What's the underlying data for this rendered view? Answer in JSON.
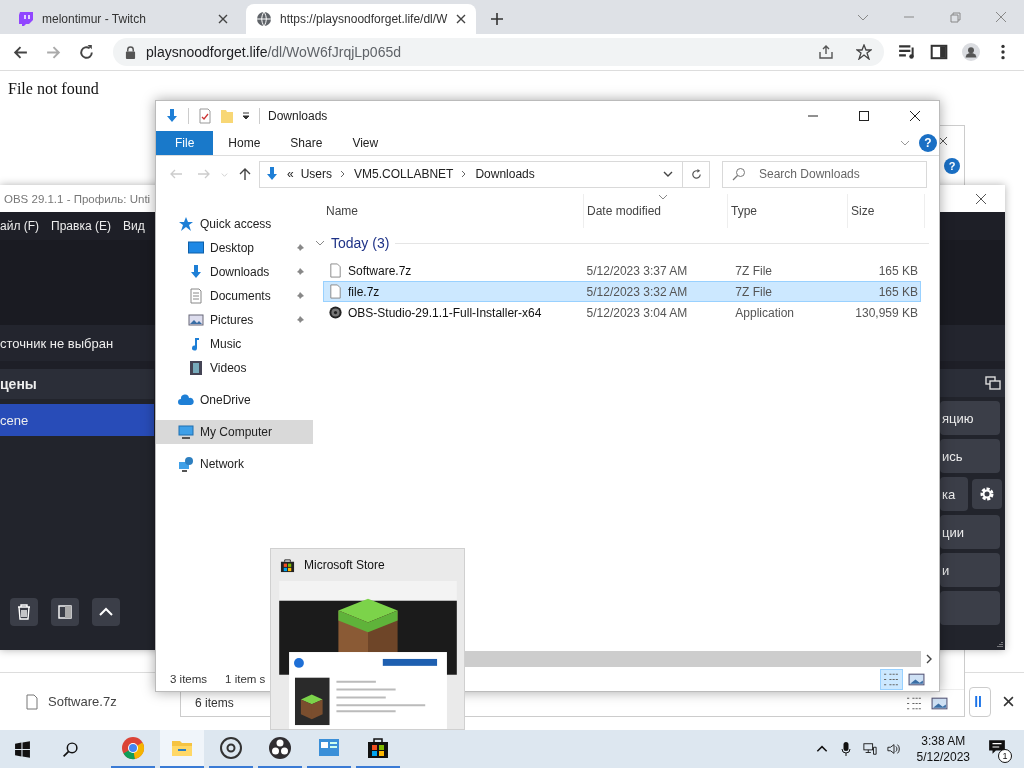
{
  "browser": {
    "tabs": [
      {
        "title": "melontimur - Twitch",
        "selected": false
      },
      {
        "title": "https://playsnoodforget.life/dl/W",
        "selected": true
      }
    ],
    "url": {
      "domain": "playsnoodforget.life",
      "path": "/dl/WoW6fJrqjLp065d"
    },
    "page_text": "File not found",
    "download_bar": {
      "file": "Software.7z",
      "button_text": "ll"
    }
  },
  "obs": {
    "title": "OBS 29.1.1 - Профиль: Unti",
    "menu": [
      "айл (F)",
      "Правка (E)",
      "Вид"
    ],
    "no_source": "сточник не выбран",
    "scenes_title": "цены",
    "scenes": [
      {
        "name": "cene",
        "selected": true
      }
    ],
    "controls": [
      {
        "label": "яцию",
        "kind": "button"
      },
      {
        "label": "ись",
        "kind": "button"
      },
      {
        "label": "ка",
        "kind": "settings"
      },
      {
        "label": "ции",
        "kind": "button"
      },
      {
        "label": "и",
        "kind": "button"
      }
    ]
  },
  "back_explorer": {
    "help": "?",
    "status": "6 items"
  },
  "explorer": {
    "title": "Downloads",
    "ribbon_tabs": [
      {
        "label": "File",
        "selected": true
      },
      {
        "label": "Home",
        "selected": false
      },
      {
        "label": "Share",
        "selected": false
      },
      {
        "label": "View",
        "selected": false
      }
    ],
    "help": "?",
    "breadcrumb_prefix": "«",
    "breadcrumb": [
      "Users",
      "VM5.COLLABNET",
      "Downloads"
    ],
    "search": {
      "placeholder": "Search Downloads"
    },
    "nav": [
      {
        "label": "Quick access",
        "pinned": false,
        "selected": false,
        "children": [
          {
            "label": "Desktop",
            "pinned": true,
            "selected": false
          },
          {
            "label": "Downloads",
            "pinned": true,
            "selected": false
          },
          {
            "label": "Documents",
            "pinned": true,
            "selected": false
          },
          {
            "label": "Pictures",
            "pinned": true,
            "selected": false
          },
          {
            "label": "Music",
            "pinned": false,
            "selected": false
          },
          {
            "label": "Videos",
            "pinned": false,
            "selected": false
          }
        ]
      },
      {
        "label": "OneDrive",
        "pinned": false,
        "selected": false
      },
      {
        "label": "My Computer",
        "pinned": false,
        "selected": true
      },
      {
        "label": "Network",
        "pinned": false,
        "selected": false
      }
    ],
    "columns": [
      "Name",
      "Date modified",
      "Type",
      "Size"
    ],
    "group": "Today (3)",
    "files": [
      {
        "name": "Software.7z",
        "date": "5/12/2023 3:37 AM",
        "type": "7Z File",
        "size": "165 KB",
        "kind": "file",
        "selected": false
      },
      {
        "name": "file.7z",
        "date": "5/12/2023 3:32 AM",
        "type": "7Z File",
        "size": "165 KB",
        "kind": "file",
        "selected": true
      },
      {
        "name": "OBS-Studio-29.1.1-Full-Installer-x64",
        "date": "5/12/2023 3:04 AM",
        "type": "Application",
        "size": "130,959 KB",
        "kind": "application",
        "selected": false
      }
    ],
    "status": {
      "count": "3 items",
      "selection": "1 item s"
    }
  },
  "store_preview": {
    "title": "Microsoft Store"
  },
  "taskbar": {
    "apps": [
      {
        "running": true,
        "selected": false
      },
      {
        "running": true,
        "selected": true
      },
      {
        "running": true,
        "selected": false
      },
      {
        "running": true,
        "selected": false
      },
      {
        "running": true,
        "selected": false
      },
      {
        "running": true,
        "selected": false
      }
    ],
    "time": "3:38 AM",
    "date": "5/12/2023",
    "notifications": "1"
  }
}
